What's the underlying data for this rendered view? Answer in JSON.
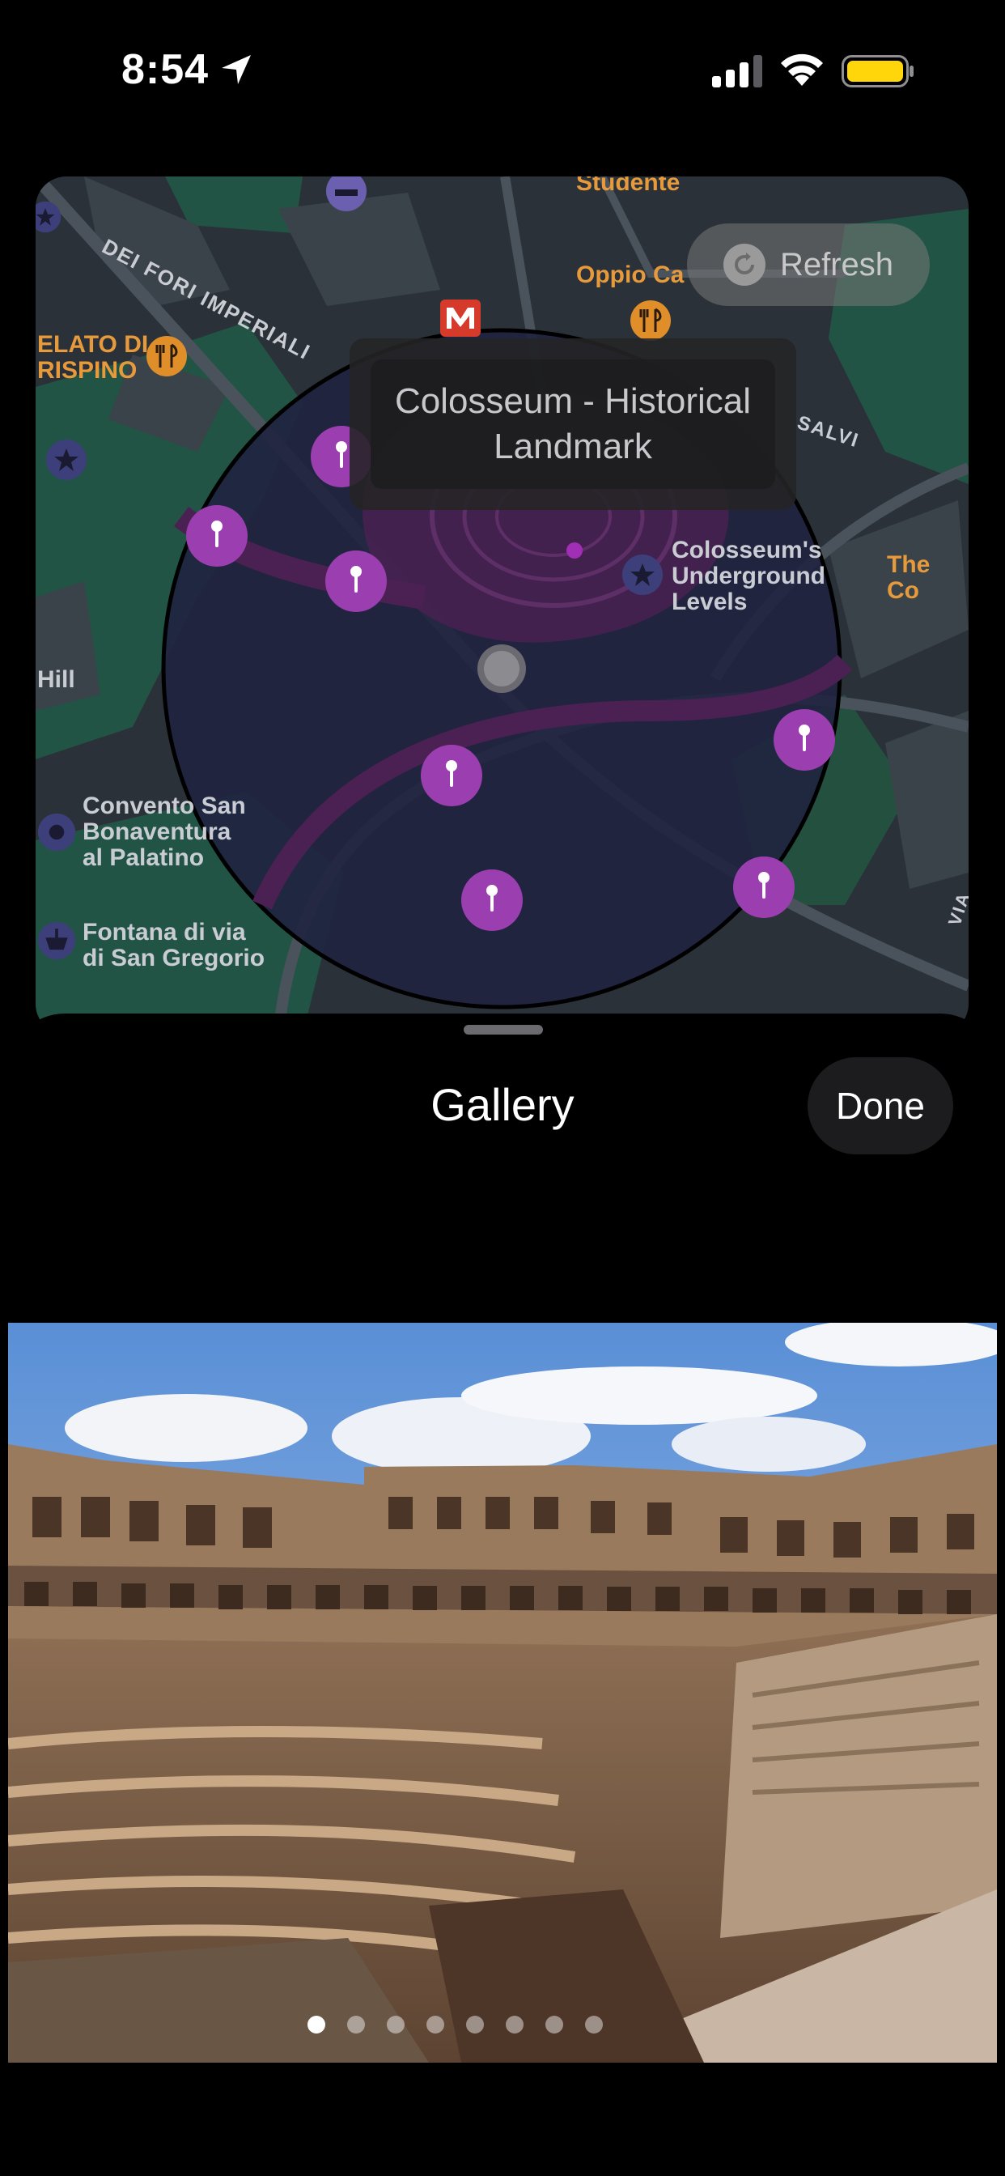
{
  "status_bar": {
    "time": "8:54"
  },
  "map": {
    "labels": {
      "via_fori_imperiali": "DEI FORI IMPERIALI",
      "studente": "Studente",
      "oppio": "Oppio Ca",
      "elato_line1": "ELATO DI",
      "elato_line2": "RISPINO",
      "salvi": "SALVI",
      "underground_line1": "Colosseum's",
      "underground_line2": "Underground",
      "underground_line3": "Levels",
      "the_co": "The Co",
      "hill": "Hill",
      "convento_line1": "Convento San",
      "convento_line2": "Bonaventura",
      "convento_line3": "al Palatino",
      "fontana_line1": "Fontana di via",
      "fontana_line2": "di San Gregorio",
      "via_ostia": "VIA OSTI"
    },
    "refresh_label": "Refresh",
    "tooltip": "Colosseum - Historical Landmark",
    "pin_color": "#9b3fb0",
    "region_fill": "#1f2240"
  },
  "sheet": {
    "title": "Gallery",
    "done_label": "Done",
    "page_count": 8,
    "current_page": 1
  }
}
